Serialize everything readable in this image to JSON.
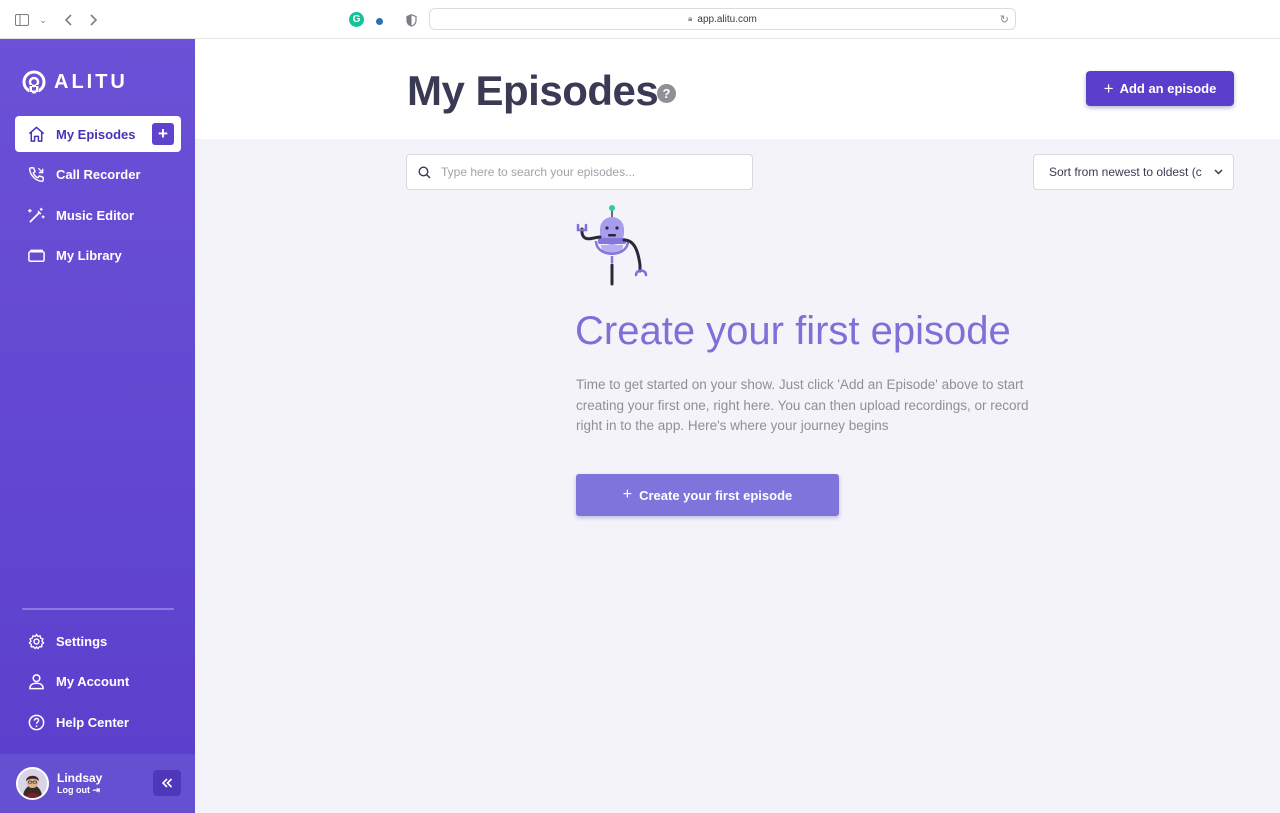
{
  "browser": {
    "url": "app.alitu.com"
  },
  "sidebar": {
    "logo_text": "ALITU",
    "items": [
      {
        "label": "My Episodes",
        "icon": "home-icon"
      },
      {
        "label": "Call Recorder",
        "icon": "phone-icon"
      },
      {
        "label": "Music Editor",
        "icon": "wand-icon"
      },
      {
        "label": "My Library",
        "icon": "folder-icon"
      }
    ],
    "bottom_items": [
      {
        "label": "Settings",
        "icon": "gear-icon"
      },
      {
        "label": "My Account",
        "icon": "user-icon"
      },
      {
        "label": "Help Center",
        "icon": "help-icon"
      }
    ],
    "user": {
      "name": "Lindsay",
      "logout_label": "Log out"
    }
  },
  "header": {
    "title": "My Episodes",
    "help_label": "?",
    "add_button_label": "Add an episode"
  },
  "toolbar": {
    "search_placeholder": "Type here to search your episodes...",
    "sort_value": "Sort from newest to oldest (c"
  },
  "empty_state": {
    "title": "Create your first episode",
    "description": "Time to get started on your show. Just click 'Add an Episode' above to start creating your first one, right here. You can then upload recordings, or record right in to the app. Here's where your journey begins",
    "button_label": "Create your first episode"
  },
  "colors": {
    "sidebar": "#5b3fcc",
    "accent": "#5b3fcc",
    "empty_title": "#7f70d8",
    "create_button": "#7f74dc",
    "background": "#f4f3fa"
  }
}
